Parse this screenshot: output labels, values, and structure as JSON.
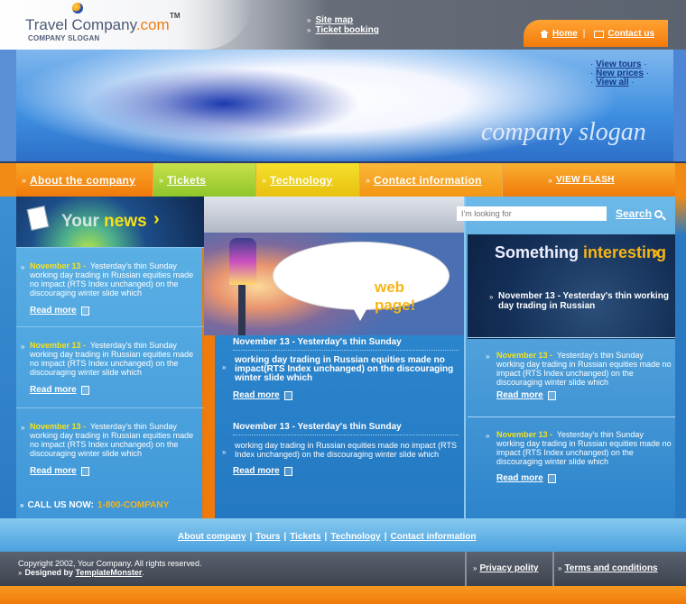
{
  "header": {
    "logo_main": "Travel Company",
    "logo_tld": ".com",
    "logo_tm": "TM",
    "logo_slogan": "COMPANY SLOGAN",
    "top_links": [
      "Site map",
      "Ticket booking"
    ],
    "home_label": "Home",
    "contact_label": "Contact us",
    "separator": "|"
  },
  "banner": {
    "slogan": "company slogan",
    "links": [
      "View tours",
      "New prices",
      "View all"
    ]
  },
  "nav": {
    "items": [
      "About the company",
      "Tickets",
      "Technology",
      "Contact information",
      "VIEW FLASH"
    ]
  },
  "search": {
    "placeholder": "I'm looking for",
    "label": "Search"
  },
  "left": {
    "title_a": "Your",
    "title_b": "news",
    "news": [
      {
        "date": "November 13 -",
        "text": "Yesterday's thin Sunday working day trading in Russian equities made no impact (RTS Index unchanged) on the discouraging winter slide which",
        "read_more": "Read more"
      },
      {
        "date": "November 13 -",
        "text": "Yesterday's thin Sunday working day trading in Russian equities made no impact (RTS Index unchanged) on the discouraging winter slide which",
        "read_more": "Read more"
      },
      {
        "date": "November 13 -",
        "text": "Yesterday's thin Sunday working day trading in Russian equities made no impact (RTS Index unchanged) on the discouraging winter slide which",
        "read_more": "Read more"
      }
    ],
    "call_label": "CALL US NOW:",
    "call_number": "1-800-COMPANY"
  },
  "middle": {
    "bubble_text": "web page!",
    "items": [
      {
        "heading": "November 13 -  Yesterday's thin Sunday",
        "body": "working day trading in Russian equities  made no impact(RTS Index unchanged) on the discouraging winter slide which",
        "read_more": "Read more"
      },
      {
        "heading": "November 13 -  Yesterday's thin Sunday",
        "body": "working day trading in Russian equities  made no impact (RTS Index unchanged) on the discouraging winter slide which",
        "read_more": "Read more"
      }
    ]
  },
  "right": {
    "title_a": "Something",
    "title_b": "interesting",
    "featured": "November 13 -  Yesterday's thin working day trading in Russian",
    "items": [
      {
        "date": "November 13 -",
        "text": "Yesterday's thin Sunday working day trading in Russian equities made no impact (RTS Index unchanged) on the discouraging winter slide which",
        "read_more": "Read more"
      },
      {
        "date": "November 13 -",
        "text": "Yesterday's thin Sunday working day trading in Russian equities made no impact (RTS Index unchanged) on the discouraging winter slide which",
        "read_more": "Read more"
      }
    ]
  },
  "footer_nav": {
    "links": [
      "About company",
      "Tours",
      "Tickets",
      "Technology",
      "Contact information"
    ],
    "separator": "|"
  },
  "footer": {
    "copyright": "Copyright 2002, Your Company. All rights reserved.",
    "designed_by_label": "Designed by",
    "designed_by_link": "TemplateMonster",
    "designed_by_end": ".",
    "privacy": "Privacy polity",
    "terms": "Terms and conditions"
  },
  "colors": {
    "accent_orange": "#f07a0a",
    "accent_yellow": "#f7e01a",
    "main_blue": "#2a7ac3"
  }
}
